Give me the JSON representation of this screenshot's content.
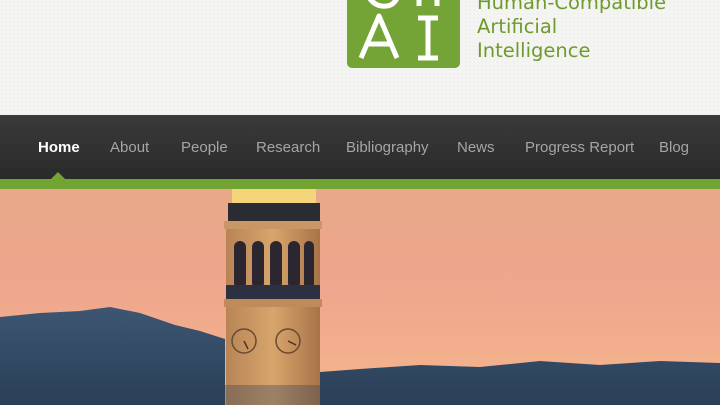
{
  "logo": {
    "mark_line1": "CH",
    "mark_line2": "AI",
    "name_lines": [
      "Human-Compatible",
      "Artificial",
      "Intelligence"
    ],
    "brand_color": "#74a435"
  },
  "nav": {
    "items": [
      {
        "label": "Home",
        "active": true
      },
      {
        "label": "About",
        "active": false
      },
      {
        "label": "People",
        "active": false
      },
      {
        "label": "Research",
        "active": false
      },
      {
        "label": "Bibliography",
        "active": false
      },
      {
        "label": "News",
        "active": false
      },
      {
        "label": "Progress Report",
        "active": false
      },
      {
        "label": "Blog",
        "active": false
      }
    ],
    "background": "#2f2f2f",
    "accent": "#72a434"
  },
  "hero": {
    "description_icon": "campanile-tower-sunset-photo"
  }
}
